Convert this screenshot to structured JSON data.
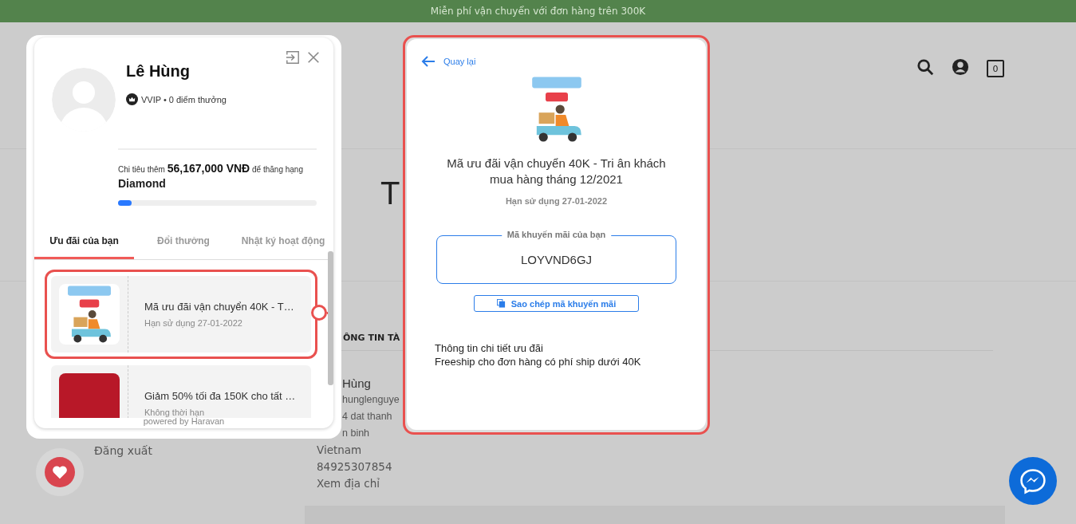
{
  "announcement_bar": {
    "text": "Miễn phí vận chuyển với đơn hàng trên 300K"
  },
  "header": {
    "cart_count": "0"
  },
  "page": {
    "heading_fragment": "T",
    "section_title": "ÔNG TIN TÀ",
    "account_lines": [
      "Hùng",
      "hunglenguye",
      "4 dat thanh",
      "n binh",
      "Vietnam",
      "84925307854",
      "Xem địa chỉ"
    ],
    "logout": "Đăng xuất"
  },
  "profile_panel": {
    "name": "Lê Hùng",
    "membership": "VVIP • 0 điểm thưởng",
    "progress_text": "Chi tiêu thêm **56,167,000 VNĐ** để thăng hạng",
    "next_tier": "Diamond",
    "level": 0.07,
    "tabs": [
      {
        "label": "Ưu đãi của bạn",
        "selected": true
      },
      {
        "label": "Đổi thưởng",
        "selected": false
      },
      {
        "label": "Nhật ký hoạt động",
        "selected": false
      }
    ],
    "vouchers": [
      {
        "kind": "freeship",
        "title": "Mã ưu đãi vận chuyển 40K - T…",
        "expiry": "Hạn sử dụng 27-01-2022",
        "selected": true
      },
      {
        "kind": "christmas",
        "title": "Giảm 50% tối đa 150K cho tất …",
        "expiry": "Không thời hạn",
        "selected": false
      }
    ],
    "footer": "powered by Haravan"
  },
  "voucher_detail": {
    "back": "Quay lại",
    "title": "Mã ưu đãi vận chuyển 40K - Tri ân khách mua hàng tháng 12/2021",
    "expiry": "Hạn sử dụng 27-01-2022",
    "code_label": "Mã khuyến mãi của bạn",
    "code": "LOYVND6GJ",
    "copy_button": "Sao chép mã khuyến mãi",
    "details_title": "Thông tin chi tiết ưu đãi",
    "details_text": "Freeship cho đơn hàng có phí ship dưới 40K"
  }
}
